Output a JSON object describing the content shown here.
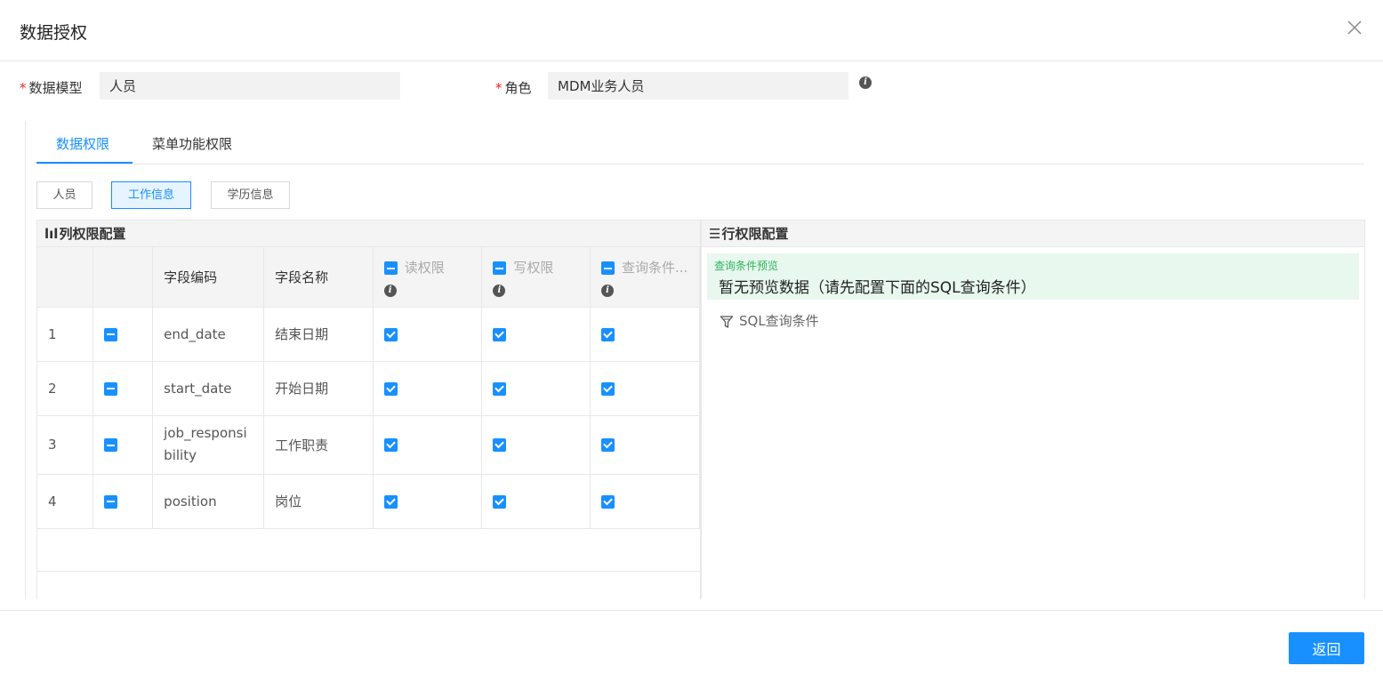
{
  "dialog": {
    "title": "数据授权",
    "close_icon": "close-icon"
  },
  "form": {
    "model": {
      "label": "数据模型",
      "value": "人员"
    },
    "role": {
      "label": "角色",
      "value": "MDM业务人员"
    }
  },
  "tabs": [
    {
      "label": "数据权限",
      "active": true
    },
    {
      "label": "菜单功能权限",
      "active": false
    }
  ],
  "segments": [
    {
      "label": "人员",
      "active": false
    },
    {
      "label": "工作信息",
      "active": true
    },
    {
      "label": "学历信息",
      "active": false
    }
  ],
  "column_panel": {
    "title": "列权限配置",
    "glyph": "lıl",
    "headers": {
      "code": "字段编码",
      "name": "字段名称",
      "read": "读权限",
      "write": "写权限",
      "query": "查询条件..."
    },
    "rows": [
      {
        "index": "1",
        "code": "end_date",
        "name": "结束日期"
      },
      {
        "index": "2",
        "code": "start_date",
        "name": "开始日期"
      },
      {
        "index": "3",
        "code": "job_responsi\nbility",
        "name": "工作职责"
      },
      {
        "index": "4",
        "code": "position",
        "name": "岗位"
      }
    ]
  },
  "row_panel": {
    "title": "行权限配置",
    "glyph": "☰",
    "preview_title": "查询条件预览",
    "preview_text": "暂无预览数据（请先配置下面的SQL查询条件）",
    "sql_condition": "SQL查询条件"
  },
  "footer": {
    "back_label": "返回"
  },
  "colors": {
    "primary": "#1890ff",
    "required": "#f5222d",
    "preview_bg": "#e8f8ee",
    "preview_title": "#2db35a"
  }
}
